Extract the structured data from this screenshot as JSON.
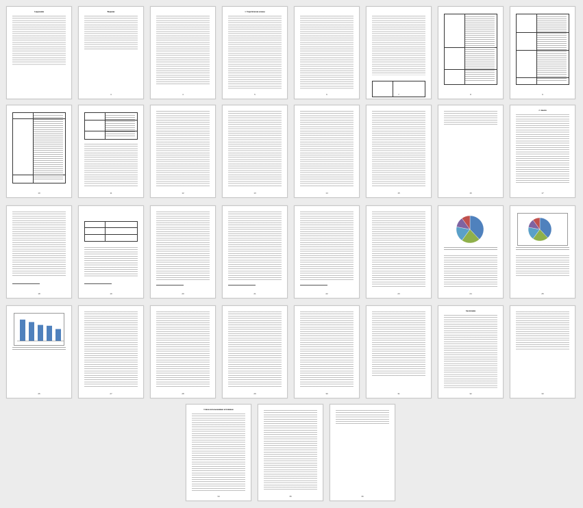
{
  "document": {
    "pages": [
      {
        "title": "Содержание",
        "number": ""
      },
      {
        "title": "Введение",
        "number": "3"
      },
      {
        "title": "",
        "number": "4"
      },
      {
        "title": "1. Теоретические основы",
        "number": "5"
      },
      {
        "title": "",
        "number": "6"
      },
      {
        "title": "",
        "number": "7"
      },
      {
        "title": "",
        "number": "8"
      },
      {
        "title": "",
        "number": "9"
      },
      {
        "title": "",
        "number": "10"
      },
      {
        "title": "",
        "number": "11"
      },
      {
        "title": "",
        "number": "12"
      },
      {
        "title": "",
        "number": "13"
      },
      {
        "title": "",
        "number": "14"
      },
      {
        "title": "",
        "number": "15"
      },
      {
        "title": "",
        "number": "16"
      },
      {
        "title": "2. Анализ",
        "number": "17"
      },
      {
        "title": "",
        "number": "18"
      },
      {
        "title": "",
        "number": "19"
      },
      {
        "title": "",
        "number": "20"
      },
      {
        "title": "",
        "number": "21"
      },
      {
        "title": "",
        "number": "22"
      },
      {
        "title": "",
        "number": "23"
      },
      {
        "title": "",
        "number": "24"
      },
      {
        "title": "",
        "number": "25"
      },
      {
        "title": "",
        "number": "26"
      },
      {
        "title": "",
        "number": "27"
      },
      {
        "title": "",
        "number": "28"
      },
      {
        "title": "",
        "number": "29"
      },
      {
        "title": "",
        "number": "30"
      },
      {
        "title": "",
        "number": "31"
      },
      {
        "title": "Заключение",
        "number": "32"
      },
      {
        "title": "",
        "number": "33"
      },
      {
        "title": "Список использованных источников",
        "number": "34"
      },
      {
        "title": "",
        "number": "35"
      },
      {
        "title": "",
        "number": "36"
      }
    ]
  },
  "charts": {
    "pie_colors": [
      "#4f81bd",
      "#8fb04a",
      "#5aa0c8",
      "#7f63a1",
      "#c0504d"
    ],
    "bar_color": "#4f81bd",
    "bar_values": [
      5.2,
      4.6,
      3.9,
      3.7,
      2.9
    ],
    "pie_values": [
      38,
      22,
      18,
      12,
      10
    ]
  }
}
